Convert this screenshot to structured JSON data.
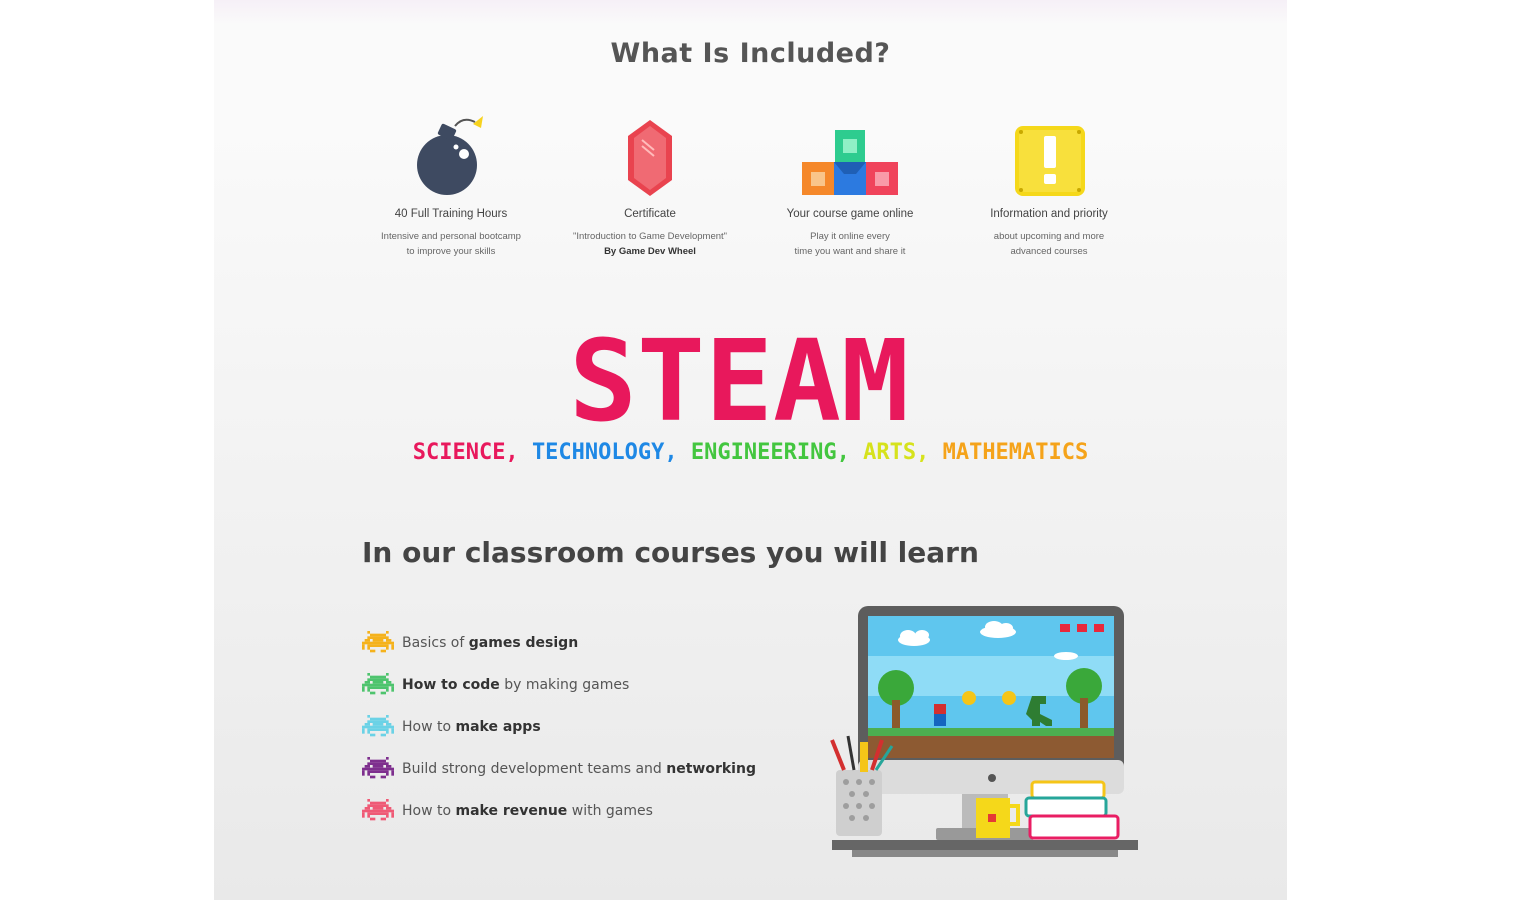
{
  "heading": "What Is Included?",
  "features": [
    {
      "icon": "bomb-icon",
      "title": "40 Full Training Hours",
      "desc1": "Intensive and personal bootcamp",
      "desc2": "to improve your skills"
    },
    {
      "icon": "gem-icon",
      "title": "Certificate",
      "desc1": "\"Introduction to Game Development\"",
      "desc2": "By Game Dev Wheel"
    },
    {
      "icon": "blocks-icon",
      "title": "Your course game online",
      "desc1": "Play it online every",
      "desc2": "time you want and share it"
    },
    {
      "icon": "exclamation-block-icon",
      "title": "Information and priority",
      "desc1": "about upcoming and more",
      "desc2": "advanced courses"
    }
  ],
  "steam": {
    "logo_text": "STEAM",
    "subtitle": [
      {
        "text": "SCIENCE,",
        "color": "#e8185c"
      },
      {
        "text": "TECHNOLOGY,",
        "color": "#1e88e5"
      },
      {
        "text": "ENGINEERING,",
        "color": "#43c63f"
      },
      {
        "text": "ARTS,",
        "color": "#d6e21c"
      },
      {
        "text": "MATHEMATICS",
        "color": "#f5a31a"
      }
    ]
  },
  "learn": {
    "heading": "In our classroom courses you will learn",
    "items": [
      {
        "color": "#f5b21c",
        "pre": "Basics of ",
        "bold": "games design",
        "post": ""
      },
      {
        "color": "#4ec46e",
        "pre": "",
        "bold": "How to code",
        "post": " by making games"
      },
      {
        "color": "#6bd2e6",
        "pre": "How to ",
        "bold": "make apps",
        "post": ""
      },
      {
        "color": "#7e2f8e",
        "pre": "Build strong development teams and ",
        "bold": "networking",
        "post": ""
      },
      {
        "color": "#ef5a76",
        "pre": "How to ",
        "bold": "make revenue",
        "post": " with games"
      }
    ]
  },
  "illustration": {
    "icon": "computer-desk-game-icon"
  }
}
